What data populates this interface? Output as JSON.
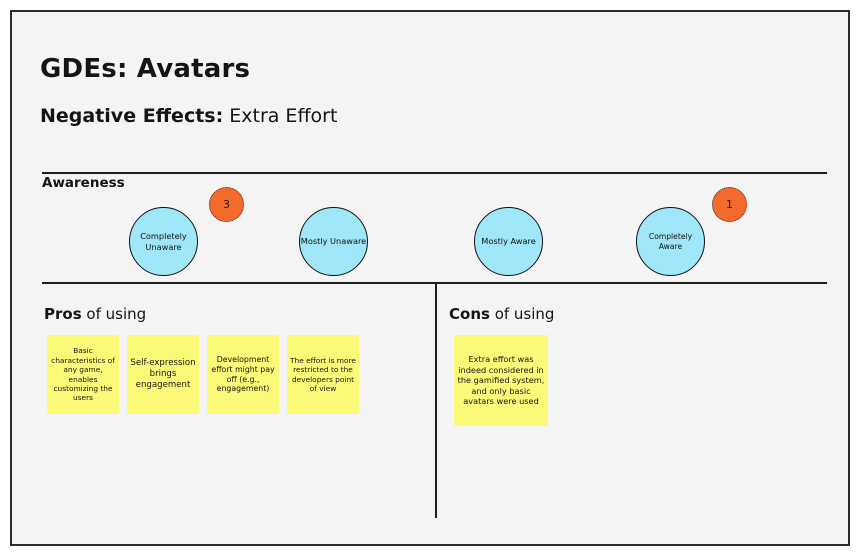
{
  "slide": {
    "title": "GDEs: Avatars",
    "subtitle_lead": "Negative Effects:",
    "subtitle_rest": " Extra Effort",
    "background_color": "#f4f4f4",
    "border_color": "#2b2b2b"
  },
  "awareness": {
    "label": "Awareness",
    "circle_color": "#9fe7f8",
    "badge_color": "#f4692c",
    "levels": [
      {
        "label": "Completely Unaware",
        "vote_count": "3"
      },
      {
        "label": "Mostly Unaware",
        "vote_count": ""
      },
      {
        "label": "Mostly Aware",
        "vote_count": ""
      },
      {
        "label": "Completely Aware",
        "vote_count": "1"
      }
    ],
    "badges": [
      {
        "value": "3",
        "attached_to": "Completely Unaware"
      },
      {
        "value": "1",
        "attached_to": "Completely Aware"
      }
    ]
  },
  "pros": {
    "heading_lead": "Pros",
    "heading_rest": " of using",
    "note_color": "#fafa78",
    "notes": [
      "Basic characteristics of any game, enables customizing the users",
      "Self-expression brings engagement",
      "Development effort might pay off (e.g., engagement)",
      "The effort is more restricted to the developers point of view"
    ]
  },
  "cons": {
    "heading_lead": "Cons",
    "heading_rest": " of using",
    "note_color": "#fafa78",
    "notes": [
      "Extra effort was indeed considered in the gamified system, and only basic avatars were used"
    ]
  }
}
